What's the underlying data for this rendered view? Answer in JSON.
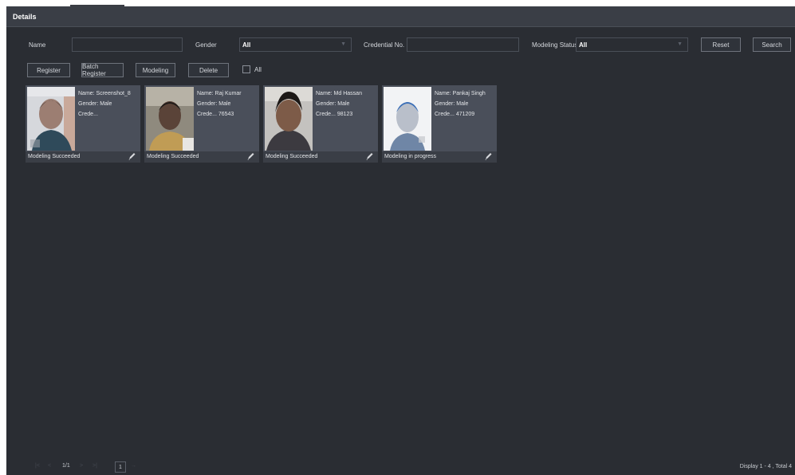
{
  "header": {
    "title": "Details"
  },
  "filters": {
    "name_label": "Name",
    "name_value": "",
    "gender_label": "Gender",
    "gender_value": "All",
    "credential_label": "Credential No.",
    "credential_value": "",
    "modeling_status_label": "Modeling Status",
    "modeling_status_value": "All",
    "reset_label": "Reset",
    "search_label": "Search"
  },
  "toolbar": {
    "register_label": "Register",
    "batch_register_label": "Batch Register",
    "modeling_label": "Modeling",
    "delete_label": "Delete",
    "select_all_label": "All"
  },
  "cards": [
    {
      "name": "Name:  Screenshot_8",
      "gender": "Gender: Male",
      "credential": "Crede...",
      "status": "Modeling Succeeded"
    },
    {
      "name": "Name:  Raj Kumar",
      "gender": "Gender: Male",
      "credential": "Crede... 76543",
      "status": "Modeling Succeeded"
    },
    {
      "name": "Name:  Md Hassan",
      "gender": "Gender: Male",
      "credential": "Crede... 98123",
      "status": "Modeling Succeeded"
    },
    {
      "name": "Name:  Pankaj Singh",
      "gender": "Gender: Male",
      "credential": "Crede... 471209",
      "status": "Modeling in progress"
    }
  ],
  "pager": {
    "first": "|<",
    "prev": "<",
    "page_info": "1/1",
    "next": ">",
    "last": ">|",
    "page_input": "1",
    "go": "→",
    "total": "Display 1 - 4 , Total 4"
  },
  "icons": {
    "edit": "pencil-icon",
    "dropdown": "chevron-down-icon"
  }
}
